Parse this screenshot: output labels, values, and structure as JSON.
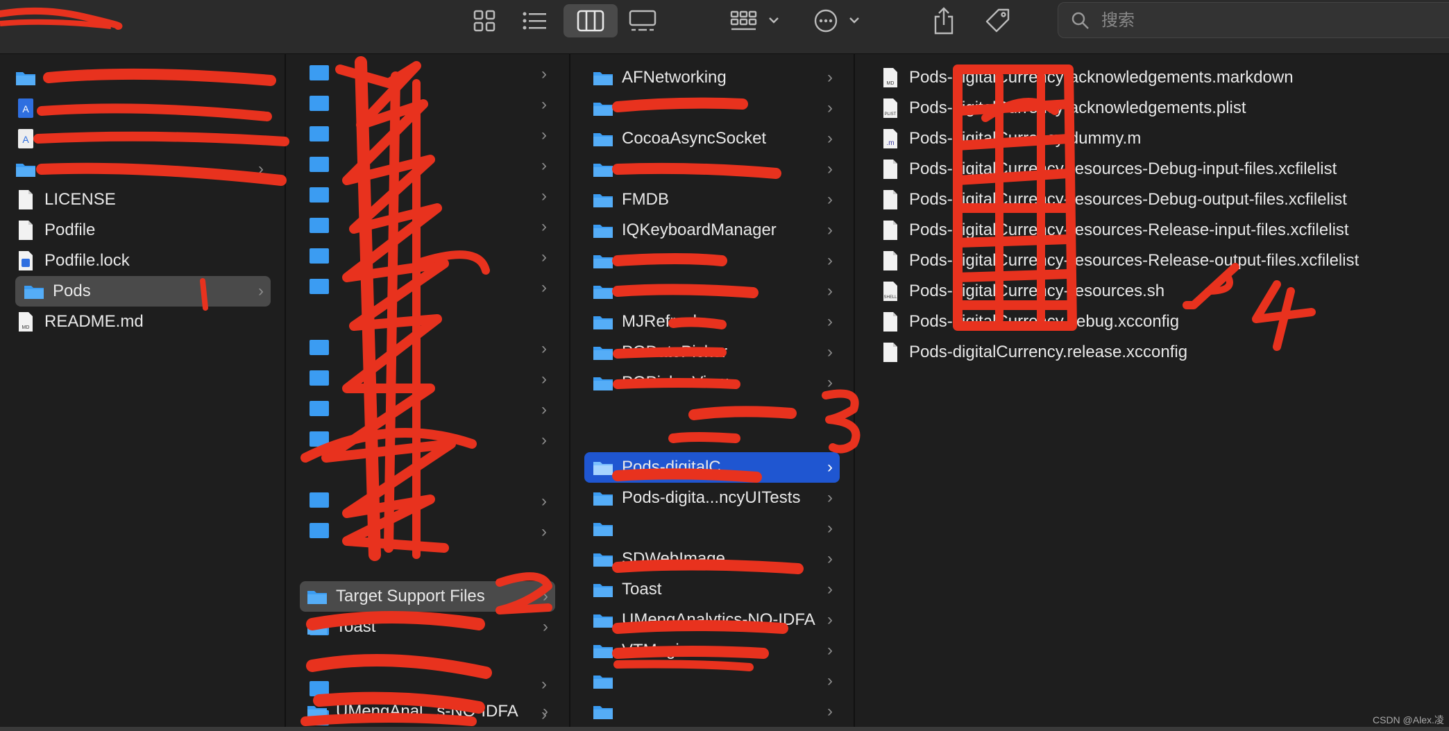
{
  "toolbar": {
    "search_placeholder": "搜索",
    "icons": [
      "icon-view-icon",
      "list-view-icon",
      "column-view-icon",
      "gallery-view-icon",
      "group-icon",
      "more-icon",
      "share-icon",
      "tag-icon",
      "search-icon"
    ]
  },
  "col1": {
    "items": [
      {
        "label": "LICENSE",
        "icon": "text-file-icon",
        "folder": false
      },
      {
        "label": "Podfile",
        "icon": "text-file-icon",
        "folder": false
      },
      {
        "label": "Podfile.lock",
        "icon": "xcode-file-icon",
        "folder": false
      },
      {
        "label": "Pods",
        "icon": "folder-icon",
        "folder": true,
        "selected": true
      },
      {
        "label": "README.md",
        "icon": "md-file-icon",
        "folder": false
      }
    ]
  },
  "col2": {
    "items": [
      {
        "label": "Target Support Files",
        "icon": "folder-icon",
        "folder": true,
        "selected": true
      },
      {
        "label": "Toast",
        "icon": "folder-icon",
        "folder": true
      },
      {
        "label": "UMengAnal...s-NO-IDFA",
        "icon": "folder-icon",
        "folder": true
      }
    ]
  },
  "col3": {
    "items": [
      {
        "label": "AFNetworking",
        "icon": "folder-icon",
        "folder": true
      },
      {
        "label": "CocoaAsyncSocket",
        "icon": "folder-icon",
        "folder": true
      },
      {
        "label": "FMDB",
        "icon": "folder-icon",
        "folder": true
      },
      {
        "label": "IQKeyboardManager",
        "icon": "folder-icon",
        "folder": true
      },
      {
        "label": "MJRefresh",
        "icon": "folder-icon",
        "folder": true
      },
      {
        "label": "PGDatePicker",
        "icon": "folder-icon",
        "folder": true
      },
      {
        "label": "PGPickerView",
        "icon": "folder-icon",
        "folder": true
      },
      {
        "label": "Pods-digitalC",
        "icon": "folder-icon",
        "folder": true,
        "selected": true
      },
      {
        "label": "Pods-digita...ncyUITests",
        "icon": "folder-icon",
        "folder": true
      },
      {
        "label": "SDWebImage",
        "icon": "folder-icon",
        "folder": true
      },
      {
        "label": "Toast",
        "icon": "folder-icon",
        "folder": true
      },
      {
        "label": "UMengAnalytics-NO-IDFA",
        "icon": "folder-icon",
        "folder": true
      },
      {
        "label": "VTMagic",
        "icon": "folder-icon",
        "folder": true
      }
    ]
  },
  "col4": {
    "items": [
      {
        "label": "Pods-digitalCurrency-acknowledgements.markdown",
        "icon": "md-file-icon"
      },
      {
        "label": "Pods-digitalCurrency-acknowledgements.plist",
        "icon": "plist-file-icon"
      },
      {
        "label": "Pods-digitalCurrency-dummy.m",
        "icon": "m-file-icon"
      },
      {
        "label": "Pods-digitalCurrency-resources-Debug-input-files.xcfilelist",
        "icon": "text-file-icon"
      },
      {
        "label": "Pods-digitalCurrency-resources-Debug-output-files.xcfilelist",
        "icon": "text-file-icon"
      },
      {
        "label": "Pods-digitalCurrency-resources-Release-input-files.xcfilelist",
        "icon": "text-file-icon"
      },
      {
        "label": "Pods-digitalCurrency-resources-Release-output-files.xcfilelist",
        "icon": "text-file-icon"
      },
      {
        "label": "Pods-digitalCurrency-resources.sh",
        "icon": "shell-file-icon"
      },
      {
        "label": "Pods-digitalCurrency.debug.xcconfig",
        "icon": "text-file-icon"
      },
      {
        "label": "Pods-digitalCurrency.release.xcconfig",
        "icon": "text-file-icon"
      }
    ]
  },
  "annotations": {
    "n1": "1",
    "n2": "2",
    "n3": "3",
    "n4": "4"
  },
  "watermark": "CSDN @Alex.凌",
  "colors": {
    "selected_blue": "#1f56d1",
    "selected_gray": "#4a4a4a",
    "marker_red": "#e8321e",
    "folder_blue": "#3b9cf2"
  }
}
